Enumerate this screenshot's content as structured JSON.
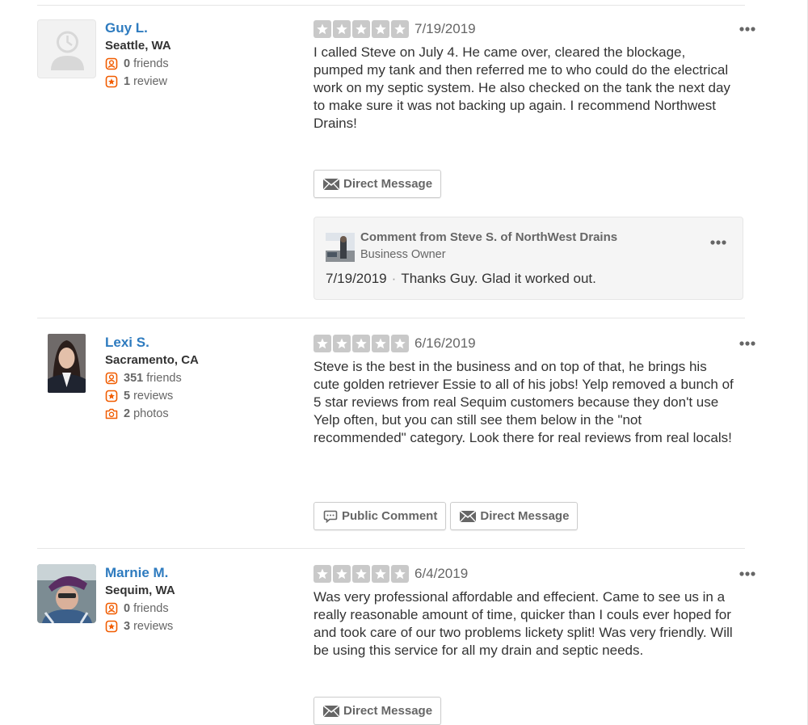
{
  "reviews": [
    {
      "user": {
        "name": "Guy L.",
        "location": "Seattle, WA",
        "friends_count": "0",
        "friends_label": "friends",
        "reviews_count": "1",
        "reviews_label": "review"
      },
      "rating": 5,
      "date": "7/19/2019",
      "text": "I called Steve on July 4.  He came over, cleared the blockage, pumped my tank and then referred me to who could do the electrical work on my septic system.  He also checked on the tank the next day to make sure it was not backing up again.  I recommend Northwest Drains!",
      "buttons": {
        "direct_message": "Direct Message"
      },
      "owner_comment": {
        "title": "Comment from Steve S. of NorthWest Drains",
        "role": "Business Owner",
        "date": "7/19/2019",
        "separator": "·",
        "text": "Thanks Guy. Glad it worked out."
      }
    },
    {
      "user": {
        "name": "Lexi S.",
        "location": "Sacramento, CA",
        "friends_count": "351",
        "friends_label": "friends",
        "reviews_count": "5",
        "reviews_label": "reviews",
        "photos_count": "2",
        "photos_label": "photos"
      },
      "rating": 5,
      "date": "6/16/2019",
      "text": "Steve is the best in the business and on top of that, he brings his cute golden retriever Essie to all of his jobs! Yelp removed a bunch of 5 star reviews from real Sequim customers because they don't use Yelp often, but you can still see them below in the \"not recommended\" category. Look there for real reviews from real locals!",
      "buttons": {
        "public_comment": "Public Comment",
        "direct_message": "Direct Message"
      }
    },
    {
      "user": {
        "name": "Marnie M.",
        "location": "Sequim, WA",
        "friends_count": "0",
        "friends_label": "friends",
        "reviews_count": "3",
        "reviews_label": "reviews"
      },
      "rating": 5,
      "date": "6/4/2019",
      "text": "Was very professional affordable and effecient. Came to see us in a really reasonable amount of time, quicker than I couls ever hoped for and took care of our two problems lickety split! Was very friendly. Will be using this service for all my drain and septic needs.",
      "buttons": {
        "direct_message": "Direct Message"
      }
    }
  ],
  "colors": {
    "link": "#2e7bbf",
    "icon_orange": "#f15c00",
    "star_empty": "#c9c9c9"
  }
}
